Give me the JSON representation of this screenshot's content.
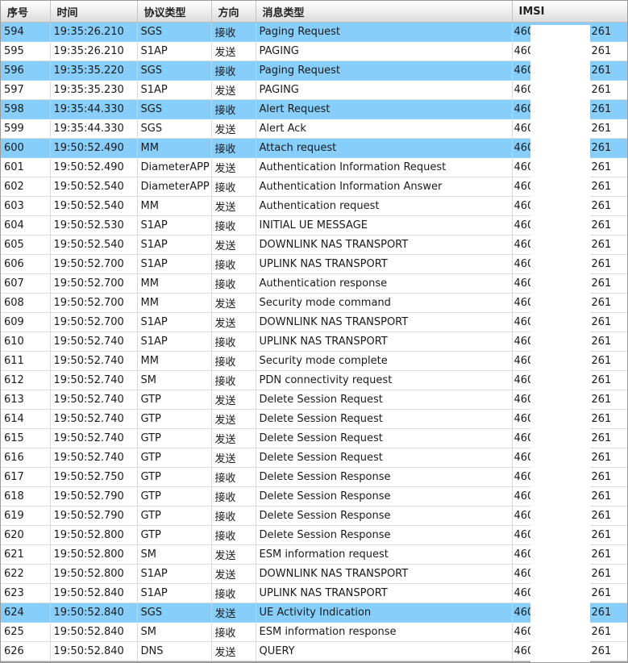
{
  "columns": [
    "序号",
    "时间",
    "协议类型",
    "方向",
    "消息类型",
    "IMSI"
  ],
  "highlight_color": "#87cefa",
  "rows": [
    {
      "seq": "594",
      "time": "19:35:26.210",
      "protocol": "SGS",
      "direction": "接收",
      "message": "Paging Request",
      "imsi_prefix": "460",
      "imsi_suffix": "261",
      "highlighted": true
    },
    {
      "seq": "595",
      "time": "19:35:26.210",
      "protocol": "S1AP",
      "direction": "发送",
      "message": "PAGING",
      "imsi_prefix": "460",
      "imsi_suffix": "261",
      "highlighted": false
    },
    {
      "seq": "596",
      "time": "19:35:35.220",
      "protocol": "SGS",
      "direction": "接收",
      "message": "Paging Request",
      "imsi_prefix": "460",
      "imsi_suffix": "261",
      "highlighted": true
    },
    {
      "seq": "597",
      "time": "19:35:35.230",
      "protocol": "S1AP",
      "direction": "发送",
      "message": "PAGING",
      "imsi_prefix": "460",
      "imsi_suffix": "261",
      "highlighted": false
    },
    {
      "seq": "598",
      "time": "19:35:44.330",
      "protocol": "SGS",
      "direction": "接收",
      "message": "Alert Request",
      "imsi_prefix": "460",
      "imsi_suffix": "261",
      "highlighted": true
    },
    {
      "seq": "599",
      "time": "19:35:44.330",
      "protocol": "SGS",
      "direction": "发送",
      "message": "Alert Ack",
      "imsi_prefix": "460",
      "imsi_suffix": "261",
      "highlighted": false
    },
    {
      "seq": "600",
      "time": "19:50:52.490",
      "protocol": "MM",
      "direction": "接收",
      "message": "Attach request",
      "imsi_prefix": "460",
      "imsi_suffix": "261",
      "highlighted": true
    },
    {
      "seq": "601",
      "time": "19:50:52.490",
      "protocol": "DiameterAPP",
      "direction": "发送",
      "message": "Authentication Information Request",
      "imsi_prefix": "460",
      "imsi_suffix": "261",
      "highlighted": false
    },
    {
      "seq": "602",
      "time": "19:50:52.540",
      "protocol": "DiameterAPP",
      "direction": "接收",
      "message": "Authentication Information Answer",
      "imsi_prefix": "460",
      "imsi_suffix": "261",
      "highlighted": false
    },
    {
      "seq": "603",
      "time": "19:50:52.540",
      "protocol": "MM",
      "direction": "发送",
      "message": "Authentication request",
      "imsi_prefix": "460",
      "imsi_suffix": "261",
      "highlighted": false
    },
    {
      "seq": "604",
      "time": "19:50:52.530",
      "protocol": "S1AP",
      "direction": "接收",
      "message": "INITIAL UE MESSAGE",
      "imsi_prefix": "460",
      "imsi_suffix": "261",
      "highlighted": false
    },
    {
      "seq": "605",
      "time": "19:50:52.540",
      "protocol": "S1AP",
      "direction": "发送",
      "message": "DOWNLINK NAS TRANSPORT",
      "imsi_prefix": "460",
      "imsi_suffix": "261",
      "highlighted": false
    },
    {
      "seq": "606",
      "time": "19:50:52.700",
      "protocol": "S1AP",
      "direction": "接收",
      "message": "UPLINK NAS TRANSPORT",
      "imsi_prefix": "460",
      "imsi_suffix": "261",
      "highlighted": false
    },
    {
      "seq": "607",
      "time": "19:50:52.700",
      "protocol": "MM",
      "direction": "接收",
      "message": "Authentication response",
      "imsi_prefix": "460",
      "imsi_suffix": "261",
      "highlighted": false
    },
    {
      "seq": "608",
      "time": "19:50:52.700",
      "protocol": "MM",
      "direction": "发送",
      "message": "Security mode command",
      "imsi_prefix": "460",
      "imsi_suffix": "261",
      "highlighted": false
    },
    {
      "seq": "609",
      "time": "19:50:52.700",
      "protocol": "S1AP",
      "direction": "发送",
      "message": "DOWNLINK NAS TRANSPORT",
      "imsi_prefix": "460",
      "imsi_suffix": "261",
      "highlighted": false
    },
    {
      "seq": "610",
      "time": "19:50:52.740",
      "protocol": "S1AP",
      "direction": "接收",
      "message": "UPLINK NAS TRANSPORT",
      "imsi_prefix": "460",
      "imsi_suffix": "261",
      "highlighted": false
    },
    {
      "seq": "611",
      "time": "19:50:52.740",
      "protocol": "MM",
      "direction": "接收",
      "message": "Security mode complete",
      "imsi_prefix": "460",
      "imsi_suffix": "261",
      "highlighted": false
    },
    {
      "seq": "612",
      "time": "19:50:52.740",
      "protocol": "SM",
      "direction": "接收",
      "message": "PDN connectivity request",
      "imsi_prefix": "460",
      "imsi_suffix": "261",
      "highlighted": false
    },
    {
      "seq": "613",
      "time": "19:50:52.740",
      "protocol": "GTP",
      "direction": "发送",
      "message": "Delete Session Request",
      "imsi_prefix": "460",
      "imsi_suffix": "261",
      "highlighted": false
    },
    {
      "seq": "614",
      "time": "19:50:52.740",
      "protocol": "GTP",
      "direction": "发送",
      "message": "Delete Session Request",
      "imsi_prefix": "460",
      "imsi_suffix": "261",
      "highlighted": false
    },
    {
      "seq": "615",
      "time": "19:50:52.740",
      "protocol": "GTP",
      "direction": "发送",
      "message": "Delete Session Request",
      "imsi_prefix": "460",
      "imsi_suffix": "261",
      "highlighted": false
    },
    {
      "seq": "616",
      "time": "19:50:52.740",
      "protocol": "GTP",
      "direction": "发送",
      "message": "Delete Session Request",
      "imsi_prefix": "460",
      "imsi_suffix": "261",
      "highlighted": false
    },
    {
      "seq": "617",
      "time": "19:50:52.750",
      "protocol": "GTP",
      "direction": "接收",
      "message": "Delete Session Response",
      "imsi_prefix": "460",
      "imsi_suffix": "261",
      "highlighted": false
    },
    {
      "seq": "618",
      "time": "19:50:52.790",
      "protocol": "GTP",
      "direction": "接收",
      "message": "Delete Session Response",
      "imsi_prefix": "460",
      "imsi_suffix": "261",
      "highlighted": false
    },
    {
      "seq": "619",
      "time": "19:50:52.790",
      "protocol": "GTP",
      "direction": "接收",
      "message": "Delete Session Response",
      "imsi_prefix": "460",
      "imsi_suffix": "261",
      "highlighted": false
    },
    {
      "seq": "620",
      "time": "19:50:52.800",
      "protocol": "GTP",
      "direction": "接收",
      "message": "Delete Session Response",
      "imsi_prefix": "460",
      "imsi_suffix": "261",
      "highlighted": false
    },
    {
      "seq": "621",
      "time": "19:50:52.800",
      "protocol": "SM",
      "direction": "发送",
      "message": "ESM information request",
      "imsi_prefix": "460",
      "imsi_suffix": "261",
      "highlighted": false
    },
    {
      "seq": "622",
      "time": "19:50:52.800",
      "protocol": "S1AP",
      "direction": "发送",
      "message": "DOWNLINK NAS TRANSPORT",
      "imsi_prefix": "460",
      "imsi_suffix": "261",
      "highlighted": false
    },
    {
      "seq": "623",
      "time": "19:50:52.840",
      "protocol": "S1AP",
      "direction": "接收",
      "message": "UPLINK NAS TRANSPORT",
      "imsi_prefix": "460",
      "imsi_suffix": "261",
      "highlighted": false
    },
    {
      "seq": "624",
      "time": "19:50:52.840",
      "protocol": "SGS",
      "direction": "发送",
      "message": "UE Activity Indication",
      "imsi_prefix": "460",
      "imsi_suffix": "261",
      "highlighted": true
    },
    {
      "seq": "625",
      "time": "19:50:52.840",
      "protocol": "SM",
      "direction": "接收",
      "message": "ESM information response",
      "imsi_prefix": "460",
      "imsi_suffix": "261",
      "highlighted": false
    },
    {
      "seq": "626",
      "time": "19:50:52.840",
      "protocol": "DNS",
      "direction": "发送",
      "message": "QUERY",
      "imsi_prefix": "460",
      "imsi_suffix": "261",
      "highlighted": false
    }
  ]
}
